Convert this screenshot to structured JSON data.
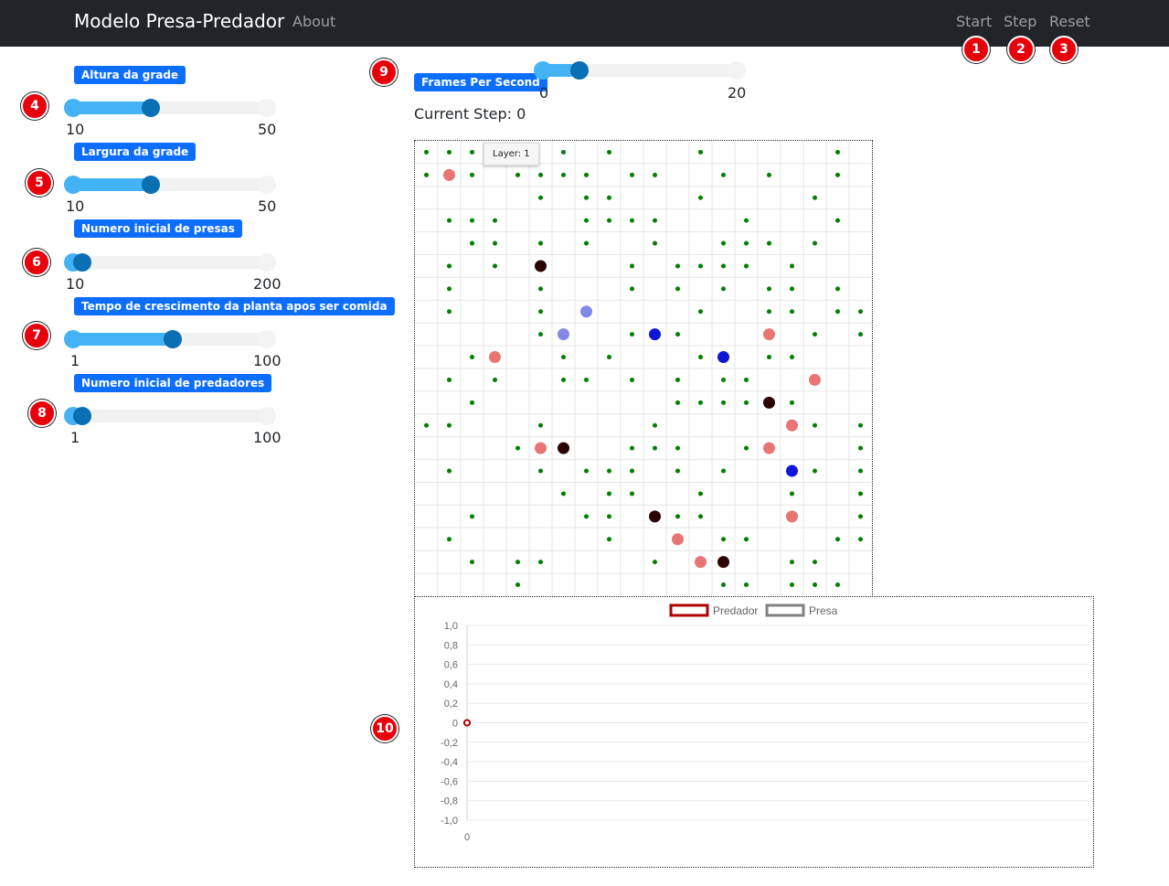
{
  "navbar": {
    "brand": "Modelo Presa-Predador",
    "about": "About",
    "start": "Start",
    "step": "Step",
    "reset": "Reset"
  },
  "annotations": [
    "1",
    "2",
    "3",
    "4",
    "5",
    "6",
    "7",
    "8",
    "9",
    "10"
  ],
  "controls": [
    {
      "label": "Altura da grade",
      "min": "10",
      "max": "50",
      "value": 25
    },
    {
      "label": "Largura da grade",
      "min": "10",
      "max": "50",
      "value": 25
    },
    {
      "label": "Numero inicial de presas",
      "min": "10",
      "max": "200",
      "value": 10
    },
    {
      "label": "Tempo de crescimento da planta apos ser comida",
      "min": "1",
      "max": "100",
      "value": 50
    },
    {
      "label": "Numero inicial de predadores",
      "min": "1",
      "max": "100",
      "value": 1
    }
  ],
  "fps": {
    "label": "Frames Per Second",
    "min": "0",
    "max": "20",
    "value": 3
  },
  "current_step": "Current Step: 0",
  "grid": {
    "tooltip": "Layer: 1",
    "cols": 20,
    "rows": 20,
    "grass_color": "#008000",
    "plants": [
      [
        0,
        0
      ],
      [
        1,
        0
      ],
      [
        2,
        0
      ],
      [
        6,
        0
      ],
      [
        8,
        0
      ],
      [
        12,
        0
      ],
      [
        18,
        0
      ],
      [
        0,
        1
      ],
      [
        2,
        1
      ],
      [
        4,
        1
      ],
      [
        5,
        1
      ],
      [
        6,
        1
      ],
      [
        7,
        1
      ],
      [
        9,
        1
      ],
      [
        10,
        1
      ],
      [
        13,
        1
      ],
      [
        15,
        1
      ],
      [
        18,
        1
      ],
      [
        5,
        2
      ],
      [
        7,
        2
      ],
      [
        8,
        2
      ],
      [
        12,
        2
      ],
      [
        17,
        2
      ],
      [
        1,
        3
      ],
      [
        2,
        3
      ],
      [
        3,
        3
      ],
      [
        7,
        3
      ],
      [
        8,
        3
      ],
      [
        9,
        3
      ],
      [
        10,
        3
      ],
      [
        14,
        3
      ],
      [
        18,
        3
      ],
      [
        2,
        4
      ],
      [
        3,
        4
      ],
      [
        5,
        4
      ],
      [
        7,
        4
      ],
      [
        10,
        4
      ],
      [
        13,
        4
      ],
      [
        14,
        4
      ],
      [
        15,
        4
      ],
      [
        17,
        4
      ],
      [
        1,
        5
      ],
      [
        3,
        5
      ],
      [
        9,
        5
      ],
      [
        11,
        5
      ],
      [
        12,
        5
      ],
      [
        13,
        5
      ],
      [
        14,
        5
      ],
      [
        16,
        5
      ],
      [
        1,
        6
      ],
      [
        5,
        6
      ],
      [
        9,
        6
      ],
      [
        11,
        6
      ],
      [
        13,
        6
      ],
      [
        15,
        6
      ],
      [
        16,
        6
      ],
      [
        18,
        6
      ],
      [
        1,
        7
      ],
      [
        5,
        7
      ],
      [
        12,
        7
      ],
      [
        15,
        7
      ],
      [
        16,
        7
      ],
      [
        18,
        7
      ],
      [
        19,
        7
      ],
      [
        5,
        8
      ],
      [
        9,
        8
      ],
      [
        11,
        8
      ],
      [
        17,
        8
      ],
      [
        19,
        8
      ],
      [
        2,
        9
      ],
      [
        6,
        9
      ],
      [
        8,
        9
      ],
      [
        12,
        9
      ],
      [
        15,
        9
      ],
      [
        16,
        9
      ],
      [
        1,
        10
      ],
      [
        3,
        10
      ],
      [
        6,
        10
      ],
      [
        7,
        10
      ],
      [
        9,
        10
      ],
      [
        11,
        10
      ],
      [
        13,
        10
      ],
      [
        14,
        10
      ],
      [
        2,
        11
      ],
      [
        11,
        11
      ],
      [
        12,
        11
      ],
      [
        13,
        11
      ],
      [
        14,
        11
      ],
      [
        16,
        11
      ],
      [
        0,
        12
      ],
      [
        1,
        12
      ],
      [
        5,
        12
      ],
      [
        10,
        12
      ],
      [
        17,
        12
      ],
      [
        19,
        12
      ],
      [
        4,
        13
      ],
      [
        9,
        13
      ],
      [
        10,
        13
      ],
      [
        11,
        13
      ],
      [
        14,
        13
      ],
      [
        19,
        13
      ],
      [
        1,
        14
      ],
      [
        5,
        14
      ],
      [
        7,
        14
      ],
      [
        8,
        14
      ],
      [
        9,
        14
      ],
      [
        11,
        14
      ],
      [
        13,
        14
      ],
      [
        17,
        14
      ],
      [
        19,
        14
      ],
      [
        6,
        15
      ],
      [
        8,
        15
      ],
      [
        9,
        15
      ],
      [
        12,
        15
      ],
      [
        16,
        15
      ],
      [
        19,
        15
      ],
      [
        2,
        16
      ],
      [
        7,
        16
      ],
      [
        8,
        16
      ],
      [
        11,
        16
      ],
      [
        12,
        16
      ],
      [
        19,
        16
      ],
      [
        1,
        17
      ],
      [
        8,
        17
      ],
      [
        13,
        17
      ],
      [
        14,
        17
      ],
      [
        18,
        17
      ],
      [
        19,
        17
      ],
      [
        2,
        18
      ],
      [
        4,
        18
      ],
      [
        5,
        18
      ],
      [
        10,
        18
      ],
      [
        16,
        18
      ],
      [
        17,
        18
      ],
      [
        4,
        19
      ],
      [
        13,
        19
      ],
      [
        14,
        19
      ],
      [
        16,
        19
      ],
      [
        17,
        19
      ],
      [
        18,
        19
      ]
    ],
    "agents": [
      {
        "x": 1,
        "y": 1,
        "color": "#e97474"
      },
      {
        "x": 5,
        "y": 5,
        "color": "#2a0404"
      },
      {
        "x": 7,
        "y": 7,
        "color": "#8088e8"
      },
      {
        "x": 6,
        "y": 8,
        "color": "#8088e8"
      },
      {
        "x": 10,
        "y": 8,
        "color": "#1016d8"
      },
      {
        "x": 15,
        "y": 8,
        "color": "#e97474"
      },
      {
        "x": 3,
        "y": 9,
        "color": "#e97474"
      },
      {
        "x": 13,
        "y": 9,
        "color": "#1016d8"
      },
      {
        "x": 17,
        "y": 10,
        "color": "#e97474"
      },
      {
        "x": 15,
        "y": 11,
        "color": "#2a0404"
      },
      {
        "x": 16,
        "y": 12,
        "color": "#e97474"
      },
      {
        "x": 5,
        "y": 13,
        "color": "#e97474"
      },
      {
        "x": 6,
        "y": 13,
        "color": "#2a0404"
      },
      {
        "x": 15,
        "y": 13,
        "color": "#e97474"
      },
      {
        "x": 16,
        "y": 14,
        "color": "#1016d8"
      },
      {
        "x": 10,
        "y": 16,
        "color": "#2a0404"
      },
      {
        "x": 16,
        "y": 16,
        "color": "#e97474"
      },
      {
        "x": 11,
        "y": 17,
        "color": "#e97474"
      },
      {
        "x": 12,
        "y": 18,
        "color": "#e97474"
      },
      {
        "x": 13,
        "y": 18,
        "color": "#2a0404"
      }
    ]
  },
  "chart_data": {
    "type": "line",
    "series": [
      {
        "name": "Predador",
        "color": "#b00000",
        "x": [
          0
        ],
        "values": [
          0
        ]
      },
      {
        "name": "Presa",
        "color": "#808080",
        "x": [
          0
        ],
        "values": [
          0
        ]
      }
    ],
    "ylim": [
      -1.0,
      1.0
    ],
    "yticks": [
      "1,0",
      "0,8",
      "0,6",
      "0,4",
      "0,2",
      "0",
      "-0,2",
      "-0,4",
      "-0,6",
      "-0,8",
      "-1,0"
    ],
    "xticks": [
      "0"
    ],
    "legend": "top",
    "grid": true
  }
}
